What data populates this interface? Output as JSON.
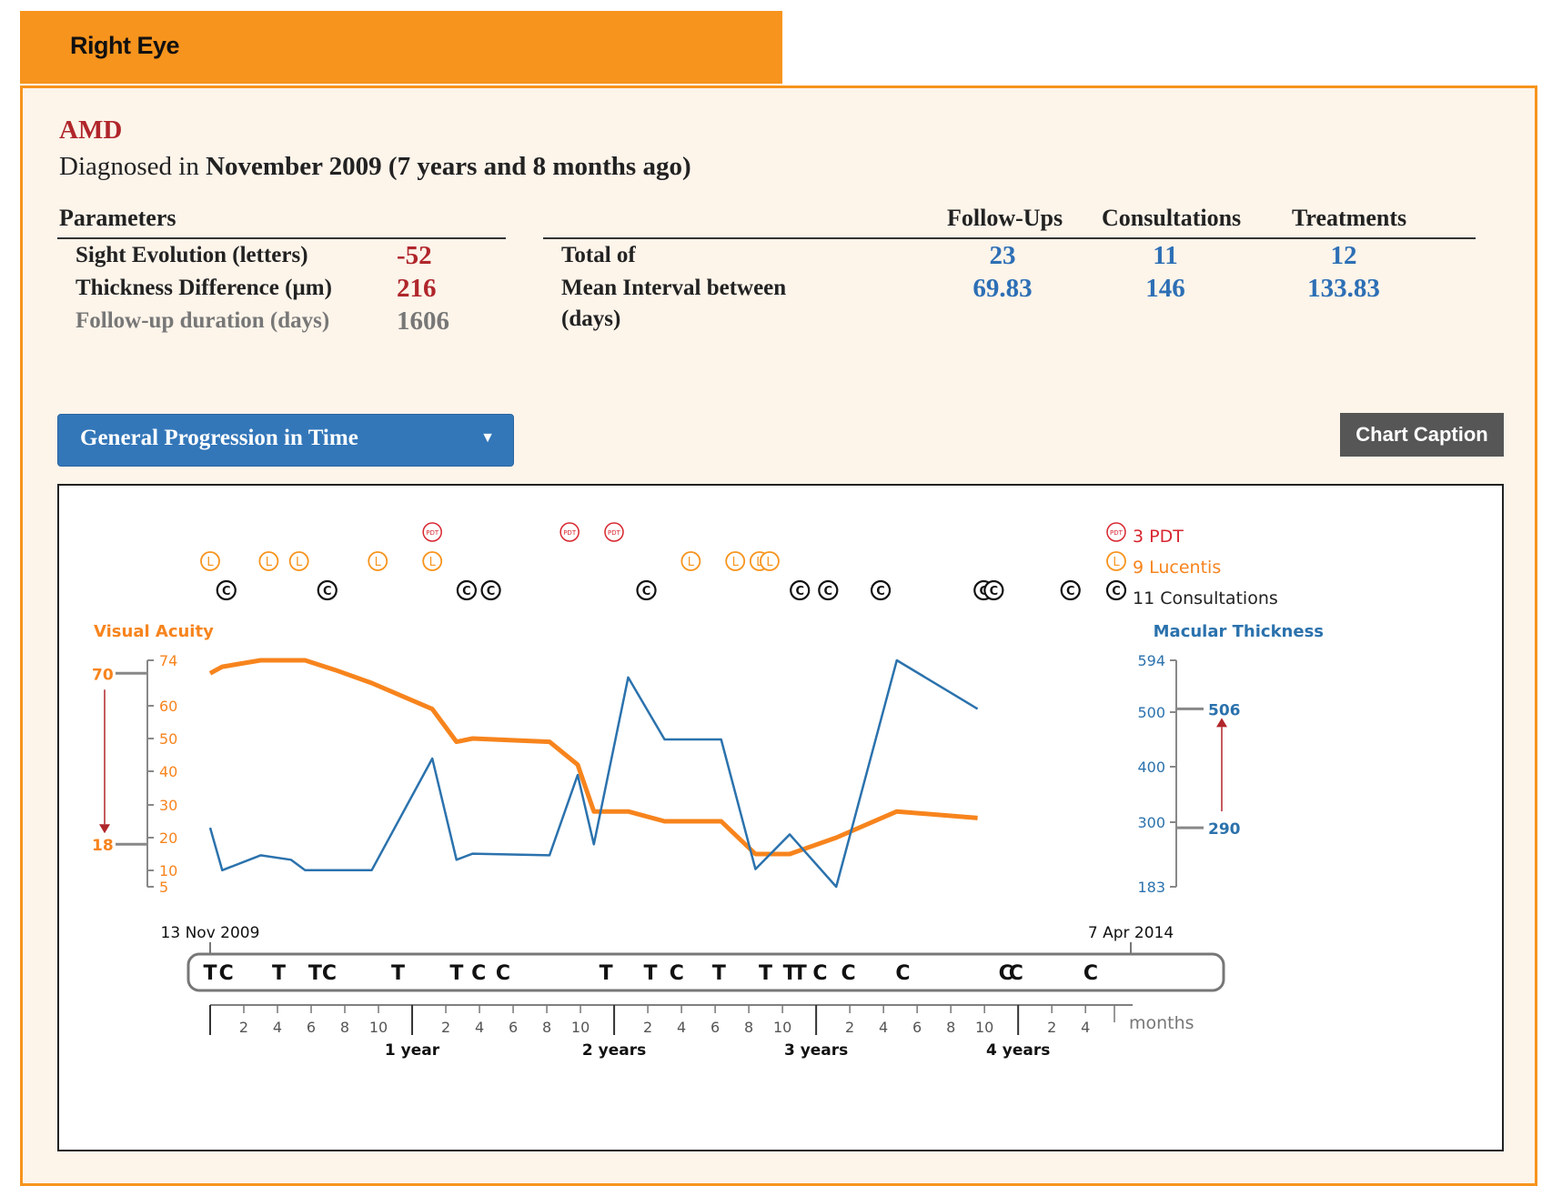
{
  "tab": {
    "title": "Right Eye"
  },
  "diagnosis": {
    "name": "AMD",
    "prefix": "Diagnosed in",
    "date": "November 2009 (7 years and 8 months ago)"
  },
  "parameters": {
    "header": "Parameters",
    "rows": [
      {
        "label": "Sight Evolution (letters)",
        "value": "-52"
      },
      {
        "label": "Thickness Difference (µm)",
        "value": "216"
      },
      {
        "label": "Follow-up duration (days)",
        "value": "1606"
      }
    ]
  },
  "stats": {
    "columns": [
      "Follow-Ups",
      "Consultations",
      "Treatments"
    ],
    "row1_label": "Total of",
    "row1_values": [
      "23",
      "11",
      "12"
    ],
    "row2_label_line1": "Mean Interval between",
    "row2_label_line2": "(days)",
    "row2_values": [
      "69.83",
      "146",
      "133.83"
    ]
  },
  "controls": {
    "dropdown_label": "General Progression in Time",
    "caption_button": "Chart Caption"
  },
  "chart_data": {
    "type": "line",
    "x_unit": "months since 13 Nov 2009",
    "start_label": "13 Nov 2009",
    "end_label": "7 Apr 2014",
    "left_axis": {
      "title": "Visual Acuity",
      "ticks": [
        5,
        10,
        20,
        30,
        40,
        50,
        60,
        74
      ],
      "range": [
        5,
        74
      ],
      "start_marker": 70,
      "end_marker": 18
    },
    "right_axis": {
      "title": "Macular Thickness",
      "ticks": [
        183,
        300,
        400,
        500,
        594
      ],
      "range": [
        183,
        594
      ],
      "start_marker": 290,
      "end_marker": 506
    },
    "colors": {
      "acuity": "#f7841d",
      "thickness": "#2b72ad",
      "pdt": "#d7262f",
      "lucentis": "#f7941d",
      "consult": "#111111",
      "arrow": "#b0262b"
    },
    "series": [
      {
        "name": "Visual Acuity",
        "points": [
          [
            0,
            70
          ],
          [
            0.6,
            72
          ],
          [
            2.5,
            74
          ],
          [
            4,
            74
          ],
          [
            4.7,
            74
          ],
          [
            6.2,
            71
          ],
          [
            8,
            67
          ],
          [
            11,
            59
          ],
          [
            12.2,
            49
          ],
          [
            13,
            50
          ],
          [
            16.8,
            49
          ],
          [
            18.2,
            42
          ],
          [
            19,
            28
          ],
          [
            20.7,
            28
          ],
          [
            22.5,
            25
          ],
          [
            24,
            25
          ],
          [
            25.3,
            25
          ],
          [
            27,
            15
          ],
          [
            28.7,
            15
          ],
          [
            31,
            20
          ],
          [
            34,
            28
          ],
          [
            38,
            26
          ]
        ]
      },
      {
        "name": "Macular Thickness",
        "points": [
          [
            0,
            290
          ],
          [
            0.6,
            213
          ],
          [
            2.5,
            240
          ],
          [
            4,
            232
          ],
          [
            4.7,
            213
          ],
          [
            6.2,
            213
          ],
          [
            8,
            213
          ],
          [
            11,
            415
          ],
          [
            12.2,
            232
          ],
          [
            13,
            243
          ],
          [
            16.8,
            240
          ],
          [
            18.2,
            385
          ],
          [
            19,
            260
          ],
          [
            20.7,
            563
          ],
          [
            22.5,
            450
          ],
          [
            24,
            450
          ],
          [
            25.3,
            450
          ],
          [
            27,
            215
          ],
          [
            28.7,
            278
          ],
          [
            31,
            183
          ],
          [
            34,
            594
          ],
          [
            38,
            506
          ]
        ]
      }
    ],
    "legend": [
      {
        "label": "3 PDT",
        "count": 3
      },
      {
        "label": "9 Lucentis",
        "count": 9
      },
      {
        "label": "11 Consultations",
        "count": 11
      }
    ],
    "pdt_months": [
      11,
      17.8,
      20
    ],
    "lucentis_months": [
      0,
      2.9,
      4.4,
      8.3,
      11,
      23.8,
      26,
      27.2,
      27.7
    ],
    "consult_months": [
      0.8,
      5.8,
      12.7,
      13.9,
      21.6,
      29.2,
      30.6,
      33.2,
      38.3,
      38.8,
      42.6
    ],
    "pdt_icon": "PDT",
    "lucentis_icon": "L",
    "consult_icon": "C",
    "timeline_events": [
      {
        "t": 0,
        "label": "T"
      },
      {
        "t": 0.8,
        "label": "C"
      },
      {
        "t": 3.4,
        "label": "T"
      },
      {
        "t": 5.2,
        "label": "T"
      },
      {
        "t": 5.9,
        "label": "C"
      },
      {
        "t": 9.3,
        "label": "T"
      },
      {
        "t": 12.2,
        "label": "T"
      },
      {
        "t": 13.3,
        "label": "C"
      },
      {
        "t": 14.5,
        "label": "C"
      },
      {
        "t": 19.6,
        "label": "T"
      },
      {
        "t": 21.8,
        "label": "T"
      },
      {
        "t": 23.1,
        "label": "C"
      },
      {
        "t": 25.2,
        "label": "T"
      },
      {
        "t": 27.5,
        "label": "T"
      },
      {
        "t": 28.7,
        "label": "T"
      },
      {
        "t": 29.2,
        "label": "T"
      },
      {
        "t": 30.2,
        "label": "C"
      },
      {
        "t": 31.6,
        "label": "C"
      },
      {
        "t": 34.3,
        "label": "C"
      },
      {
        "t": 39.4,
        "label": "C"
      },
      {
        "t": 39.9,
        "label": "C"
      },
      {
        "t": 43.6,
        "label": "C"
      }
    ],
    "x_axis": {
      "minor_ticks": [
        "2",
        "4",
        "6",
        "8",
        "10",
        "2",
        "4",
        "6",
        "8",
        "10",
        "2",
        "4",
        "6",
        "8",
        "10",
        "2",
        "4",
        "6",
        "8",
        "10",
        "2",
        "4"
      ],
      "year_labels": [
        "1 year",
        "2 years",
        "3 years",
        "4 years"
      ],
      "unit_label": "months"
    }
  }
}
